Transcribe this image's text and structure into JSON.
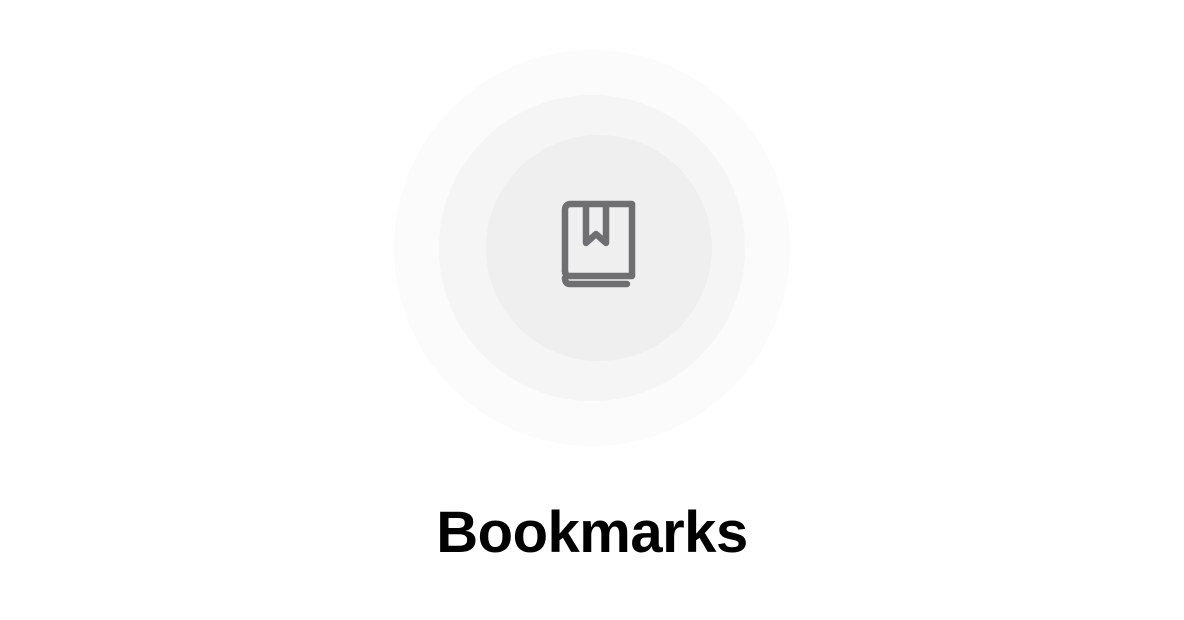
{
  "empty_state": {
    "title": "Bookmarks",
    "icon": "bookmark-book-icon"
  },
  "colors": {
    "background": "#ffffff",
    "ring_outer": "#fbfbfb",
    "ring_middle": "#f5f5f5",
    "ring_inner": "#efefef",
    "icon": "#6f6f72",
    "title": "#000000"
  }
}
